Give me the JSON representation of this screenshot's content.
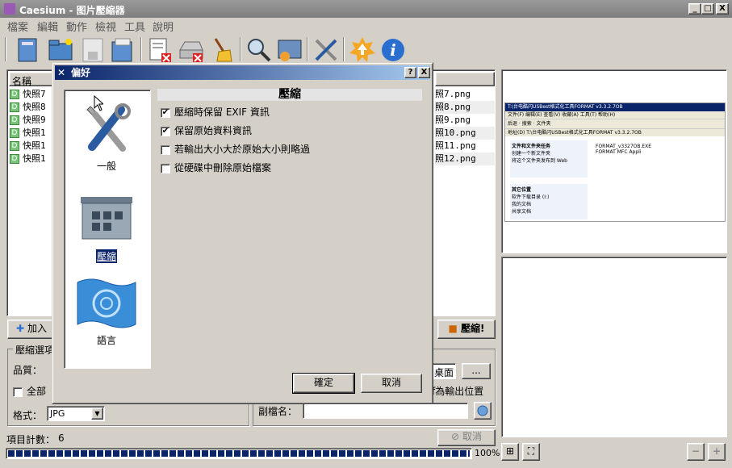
{
  "window": {
    "title": "Caesium - 图片壓縮器",
    "min": "_",
    "max": "□",
    "close": "X"
  },
  "menu": [
    "檔案",
    "編輯",
    "動作",
    "檢視",
    "工具",
    "說明"
  ],
  "toolbar": [
    "open-file-icon",
    "open-folder-icon",
    "save-icon",
    "export-icon",
    "remove-item-icon",
    "clear-list-icon",
    "clean-icon",
    "zoom-icon",
    "preview-icon",
    "settings-tools-icon",
    "update-icon",
    "info-icon"
  ],
  "list": {
    "col_name": "名稱",
    "rows": [
      "快照7",
      "快照8",
      "快照9",
      "快照1",
      "快照1",
      "快照1"
    ],
    "right_rows": [
      "照7.png",
      "照8.png",
      "照9.png",
      "照10.png",
      "照11.png",
      "照12.png"
    ]
  },
  "buttons": {
    "add": "加入",
    "compress": "壓縮!",
    "cancel": "取消"
  },
  "options": {
    "group_title": "壓縮選項",
    "quality_label": "品質：",
    "all_label": "全部",
    "format_label": "格式：",
    "format_value": "JPG",
    "output_value": "桌面",
    "browse": "...",
    "as_output": "f為輸出位置",
    "ext_label": "副檔名："
  },
  "status": {
    "count_label": "項目計數：",
    "count": "6",
    "progress_text": "100%",
    "progress": 1.0
  },
  "dialog": {
    "title": "偏好",
    "help": "?",
    "close": "X",
    "categories": [
      "一般",
      "壓縮",
      "語言"
    ],
    "section_title": "壓縮",
    "options": [
      {
        "label": "壓縮時保留 EXIF 資訊",
        "checked": true
      },
      {
        "label": "保留原始資料資訊",
        "checked": true
      },
      {
        "label": "若輸出大小大於原始大小則略過",
        "checked": false
      },
      {
        "label": "從硬碟中刪除原始檔案",
        "checked": false
      }
    ],
    "ok": "確定",
    "cancel": "取消"
  },
  "preview_image": {
    "path": "T:\\台电酷闪USBest格式化工具FORMAT v3.3.2.7OB",
    "menu": "文件(F)  编辑(E)  查看(V)  收藏(A)  工具(T)  帮助(H)",
    "back": "后退",
    "search": "搜索",
    "folders": "文件夹",
    "address_label": "地址(D)",
    "address": "T:\\台电酷闪USBest格式化工具FORMAT v3.3.2.7OB",
    "task_title": "文件和文件夹任务",
    "task1": "创建一个新文件夹",
    "task2": "将这个文件夹发布到 Web",
    "other_title": "其它位置",
    "other1": "软件下载目录 (I:)",
    "other2": "我的文档",
    "other3": "共享文档",
    "file1": "FORMAT_v3327OB.EXE",
    "file2": "FORMAT MFC Appli"
  },
  "preview_controls": {
    "fit1": "fit-icon",
    "fit2": "fullscreen-icon",
    "zoom_out": "−",
    "zoom_in": "+"
  }
}
